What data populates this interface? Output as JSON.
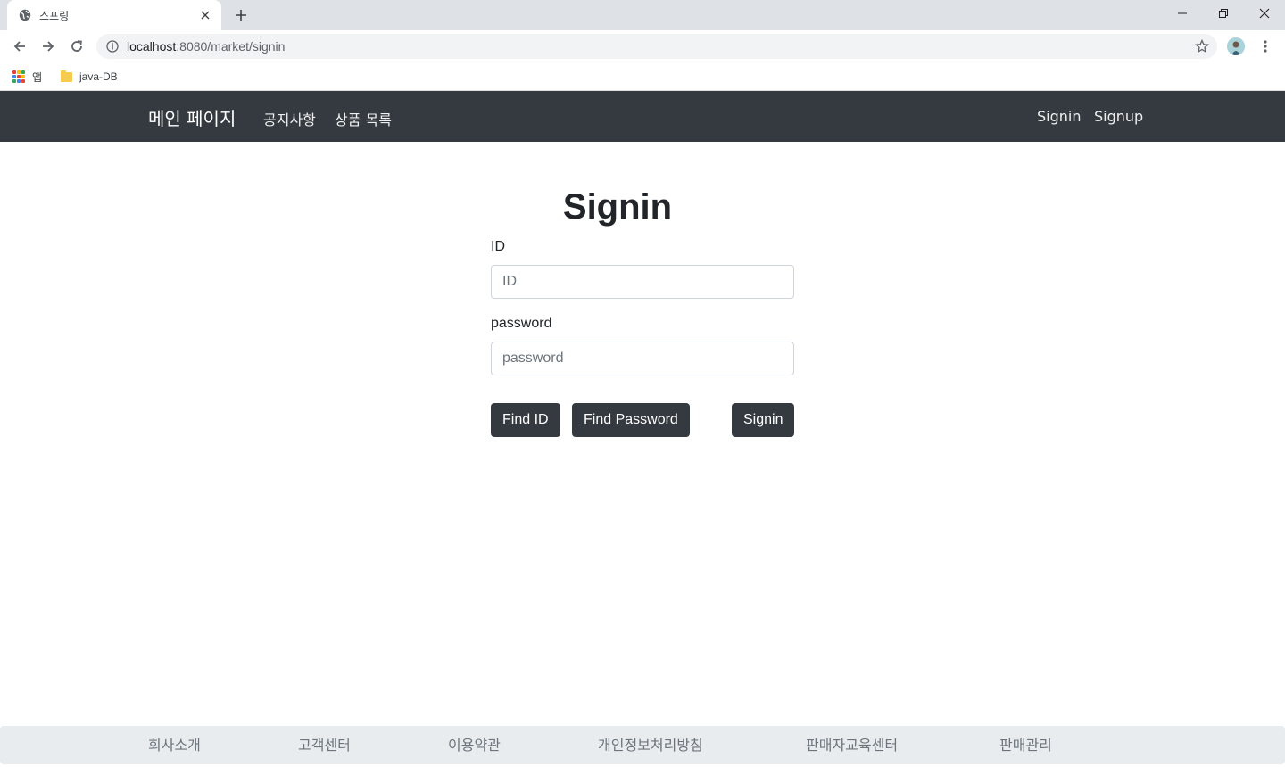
{
  "browser": {
    "tab_title": "스프링",
    "url_host": "localhost",
    "url_path": ":8080/market/signin",
    "bookmarks": [
      {
        "label": "앱",
        "icon": "apps-grid-icon"
      },
      {
        "label": "java-DB",
        "icon": "folder-icon"
      }
    ]
  },
  "navbar": {
    "brand": "메인 페이지",
    "left_links": [
      "공지사항",
      "상품 목록"
    ],
    "right_links": [
      "Signin",
      "Signup"
    ],
    "bg_color": "#343a40"
  },
  "form": {
    "title": "Signin",
    "id_label": "ID",
    "id_placeholder": "ID",
    "id_value": "",
    "password_label": "password",
    "password_placeholder": "password",
    "password_value": "",
    "buttons": {
      "find_id": "Find ID",
      "find_password": "Find Password",
      "signin": "Signin"
    }
  },
  "footer": {
    "links": [
      "회사소개",
      "고객센터",
      "이용약관",
      "개인정보처리방침",
      "판매자교육센터",
      "판매관리"
    ]
  }
}
